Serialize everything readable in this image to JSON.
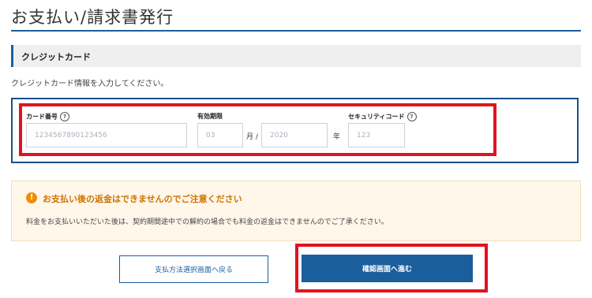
{
  "page": {
    "title": "お支払い/請求書発行"
  },
  "section": {
    "title": "クレジットカード"
  },
  "instruction": "クレジットカード情報を入力してください。",
  "form": {
    "card_number": {
      "label": "カード番号",
      "placeholder": "1234567890123456"
    },
    "expiry": {
      "label": "有効期限",
      "month_placeholder": "03",
      "month_unit": "月 /",
      "year_placeholder": "2020",
      "year_unit": "年"
    },
    "security_code": {
      "label": "セキュリティコード",
      "placeholder": "123"
    },
    "help_glyph": "?"
  },
  "notice": {
    "icon": "!",
    "title": "お支払い後の返金はできませんのでご注意ください",
    "body": "料金をお支払いいただいた後は、契約期間途中での解約の場合でも料金の返金はできませんのでご了承ください。"
  },
  "buttons": {
    "back": "支払方法選択画面へ戻る",
    "next": "確認画面へ進む"
  },
  "colors": {
    "accent": "#1b5e9e",
    "highlight_frame": "#e0141e",
    "warning": "#f28c00",
    "notice_bg": "#fff7ea"
  }
}
